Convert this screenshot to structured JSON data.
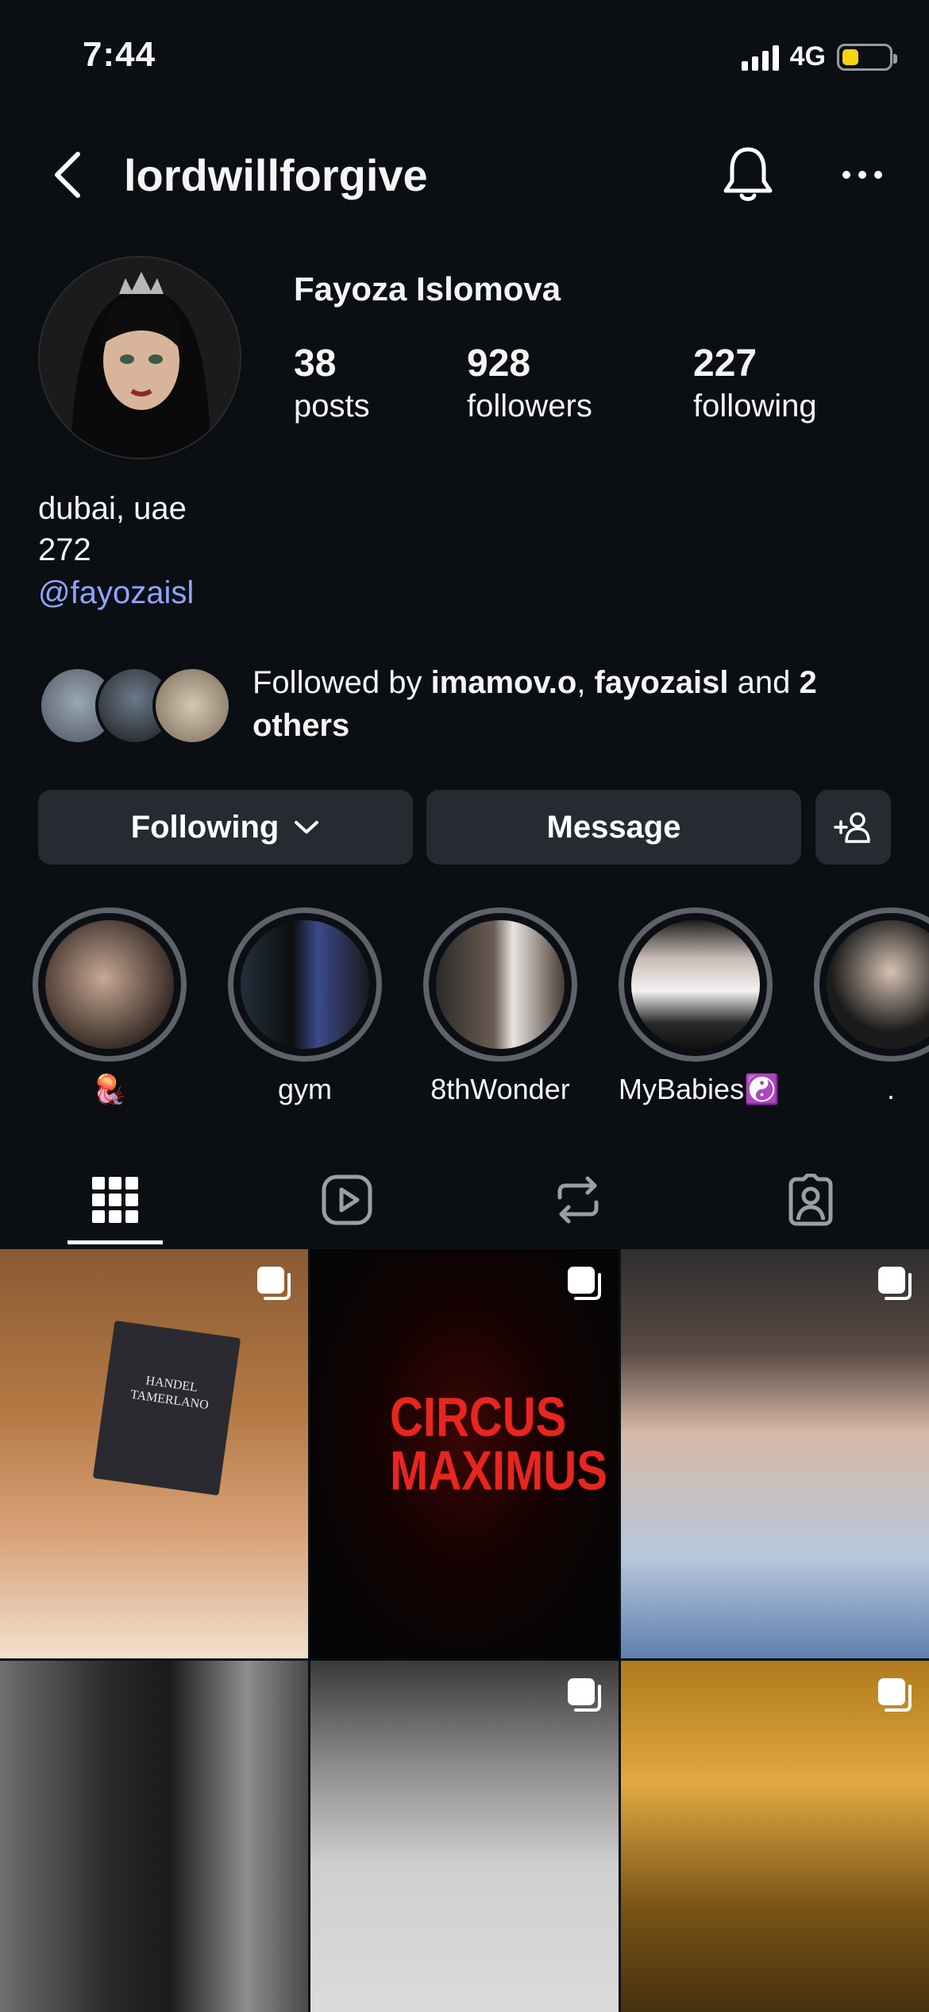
{
  "status_bar": {
    "time": "7:44",
    "network": "4G",
    "battery_level": 0.35
  },
  "header": {
    "username": "lordwillforgive"
  },
  "profile": {
    "display_name": "Fayoza Islomova",
    "stats": [
      {
        "value": "38",
        "label": "posts"
      },
      {
        "value": "928",
        "label": "followers"
      },
      {
        "value": "227",
        "label": "following"
      }
    ],
    "bio": {
      "location": "dubai, uae",
      "number": "272",
      "link": "@fayozaisl"
    }
  },
  "followed_by": {
    "prefix": "Followed by ",
    "user1": "imamov.o",
    "sep": ", ",
    "user2": "fayozaisl",
    "and": " and ",
    "others": "2 others"
  },
  "actions": {
    "following_label": "Following",
    "message_label": "Message"
  },
  "highlights": [
    {
      "label": "🪼"
    },
    {
      "label": "gym"
    },
    {
      "label": "8thWonder"
    },
    {
      "label": "MyBabies☯️"
    },
    {
      "label": "."
    }
  ],
  "grid_posts": [
    {
      "caption": "HANDEL TAMERLANO"
    },
    {
      "caption": "CIRCUS MAXIMUS"
    }
  ],
  "colors": {
    "background": "#0b0f14",
    "button_bg": "#262a31",
    "link": "#8fa4ff"
  }
}
